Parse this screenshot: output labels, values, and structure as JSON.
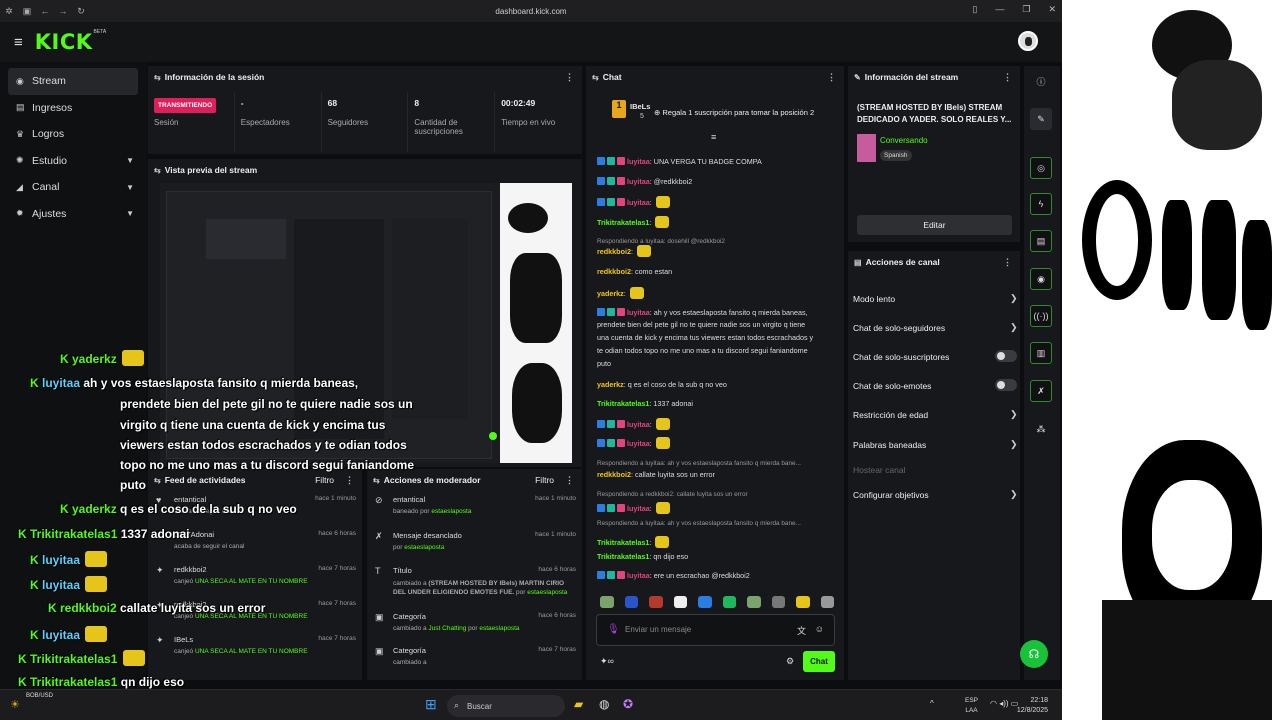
{
  "browser": {
    "url": "dashboard.kick.com"
  },
  "header": {
    "logo": "KICK",
    "beta": "BETA"
  },
  "sidebar": {
    "items": [
      {
        "label": "Stream",
        "icon": "broadcast-icon"
      },
      {
        "label": "Ingresos",
        "icon": "money-icon"
      },
      {
        "label": "Logros",
        "icon": "trophy-icon"
      },
      {
        "label": "Estudio",
        "icon": "gear-icon"
      },
      {
        "label": "Canal",
        "icon": "channel-icon"
      },
      {
        "label": "Ajustes",
        "icon": "settings-icon"
      }
    ]
  },
  "session": {
    "title": "Información de la sesión",
    "stats": [
      {
        "value": "TRANSMITIENDO",
        "label": "Sesión"
      },
      {
        "value": "-",
        "label": "Espectadores"
      },
      {
        "value": "68",
        "label": "Seguidores"
      },
      {
        "value": "8",
        "label": "Cantidad de suscripciones"
      },
      {
        "value": "00:02:49",
        "label": "Tiempo en vivo"
      }
    ]
  },
  "preview": {
    "title": "Vista previa del stream"
  },
  "feed": {
    "title": "Feed de actividades",
    "filter": "Filtro",
    "rows": [
      {
        "name": "entantical",
        "sub": "acaba de seguir el canal",
        "time": "hace 1 minuto"
      },
      {
        "name": "1337Adonai",
        "sub": "acaba de seguir el canal",
        "time": "hace 6 horas"
      },
      {
        "name": "redkkboi2",
        "sub": "canjeó",
        "reward": "UNA SECA AL MATE EN TU NOMBRE",
        "time": "hace 7 horas"
      },
      {
        "name": "redkkboi2",
        "sub": "canjeó",
        "reward": "UNA SECA AL MATE EN TU NOMBRE",
        "time": "hace 7 horas"
      },
      {
        "name": "IBeLs",
        "sub": "canjeó",
        "reward": "UNA SECA AL MATE EN TU NOMBRE",
        "time": "hace 7 horas"
      }
    ]
  },
  "mod": {
    "title": "Acciones de moderador",
    "filter": "Filtro",
    "rows": [
      {
        "name": "entantical",
        "sub": "baneado por",
        "by": "estaeslaposta",
        "time": "hace 1 minuto"
      },
      {
        "name": "Mensaje desanclado",
        "sub": "por",
        "by": "estaeslaposta",
        "time": "hace 1 minuto"
      },
      {
        "name": "Título",
        "sub": "cambiado a",
        "detail": "(STREAM HOSTED BY IBels) MARTIN CIRIO DEL UNDER ELIGIENDO EMOTES FUE.",
        "by": "estaeslaposta",
        "time": "hace 6 horas"
      },
      {
        "name": "Categoría",
        "sub": "cambiado a",
        "detail": "Just Chatting",
        "by": "estaeslaposta",
        "time": "hace 6 horas"
      },
      {
        "name": "Categoría",
        "sub": "cambiado a",
        "time": "hace 7 horas"
      }
    ]
  },
  "chat": {
    "title": "Chat",
    "top_user": "IBeLs",
    "top_count": "5",
    "gift_msg": "Regala 1 suscripción para tomar la posición 2",
    "placeholder": "Enviar un mensaje",
    "send": "Chat",
    "messages": [
      {
        "user": "luyitaa",
        "color": "#e0457b",
        "text": "UNA VERGA TU BADGE COMPA"
      },
      {
        "user": "luyitaa",
        "color": "#e0457b",
        "text": "@redkkboi2"
      },
      {
        "user": "luyitaa",
        "color": "#e0457b",
        "text": ""
      },
      {
        "user": "Trikitrakatelas1",
        "color": "#53fc18",
        "text": ""
      },
      {
        "reply": "Respondiendo a luyitaa: dosehill @redkkboi2"
      },
      {
        "user": "redkkboi2",
        "color": "#f0c419",
        "text": ""
      },
      {
        "user": "redkkboi2",
        "color": "#f0c419",
        "text": "como estan"
      },
      {
        "user": "yaderkz",
        "color": "#f0c419",
        "text": ""
      },
      {
        "user": "luyitaa",
        "color": "#e0457b",
        "text": "ah y vos estaeslaposta fansito q mierda baneas,"
      },
      {
        "text": "prendete bien del pete gil no te quiere nadie sos un virgito q tiene"
      },
      {
        "text": "una cuenta de kick y encima tus viewers estan todos escrachados y"
      },
      {
        "text": "te odian todos topo no me uno mas a tu discord segui faniandome"
      },
      {
        "text": "puto"
      },
      {
        "user": "yaderkz",
        "color": "#f0c419",
        "text": "q es el coso de la sub q no veo"
      },
      {
        "user": "Trikitrakatelas1",
        "color": "#53fc18",
        "text": "1337 adonai"
      },
      {
        "user": "luyitaa",
        "color": "#e0457b",
        "text": ""
      },
      {
        "user": "luyitaa",
        "color": "#e0457b",
        "text": ""
      },
      {
        "reply": "Respondiendo a luyitaa: ah y vos estaeslaposta fansito q mierda bane..."
      },
      {
        "user": "redkkboi2",
        "color": "#f0c419",
        "text": "callate luyita sos un error"
      },
      {
        "reply": "Respondiendo a redkkboi2: callate luyita sos un error"
      },
      {
        "user": "luyitaa",
        "color": "#e0457b",
        "text": ""
      },
      {
        "reply": "Respondiendo a luyitaa: ah y vos estaeslaposta fansito q mierda bane..."
      },
      {
        "user": "Trikitrakatelas1",
        "color": "#53fc18",
        "text": ""
      },
      {
        "user": "Trikitrakatelas1",
        "color": "#53fc18",
        "text": "qn dijo eso"
      },
      {
        "user": "luyitaa",
        "color": "#e0457b",
        "text": "ere un escrachao @redkkboi2"
      }
    ]
  },
  "stream_info": {
    "title": "Información del stream",
    "name": "(STREAM HOSTED BY IBels) STREAM DEDICADO A YADER. SOLO REALES Y...",
    "category": "Conversando",
    "language": "Spanish",
    "edit": "Editar"
  },
  "channel_actions": {
    "title": "Acciones de canal",
    "items": [
      {
        "label": "Modo lento",
        "kind": "chevron"
      },
      {
        "label": "Chat de solo-seguidores",
        "kind": "chevron"
      },
      {
        "label": "Chat de solo-suscriptores",
        "kind": "toggle"
      },
      {
        "label": "Chat de solo-emotes",
        "kind": "toggle"
      },
      {
        "label": "Restricción de edad",
        "kind": "chevron"
      },
      {
        "label": "Palabras baneadas",
        "kind": "chevron"
      },
      {
        "label": "Hostear canal",
        "kind": "disabled"
      },
      {
        "label": "Configurar objetivos",
        "kind": "chevron"
      }
    ]
  },
  "overlay": {
    "lines": [
      {
        "user": "yaderkz",
        "text": ""
      },
      {
        "user": "luyitaa",
        "text": "ah y vos estaeslaposta fansito q mierda baneas,"
      },
      {
        "text": "prendete bien del pete gil no te quiere nadie sos un"
      },
      {
        "text": "virgito q tiene una cuenta de kick y encima tus"
      },
      {
        "text": "viewers estan todos escrachados y te odian todos"
      },
      {
        "text": "topo no me uno mas a tu discord segui faniandome"
      },
      {
        "text": "puto"
      },
      {
        "user": "yaderkz",
        "text": "q es el coso de la sub q no veo"
      },
      {
        "user": "Trikitrakatelas1",
        "text": "1337 adonai"
      },
      {
        "user": "luyitaa",
        "text": ""
      },
      {
        "user": "luyitaa",
        "text": ""
      },
      {
        "user": "redkkboi2",
        "text": "callate luyita sos un error"
      },
      {
        "user": "luyitaa",
        "text": ""
      },
      {
        "user": "Trikitrakatelas1",
        "text": ""
      },
      {
        "user": "Trikitrakatelas1",
        "text": "qn dijo eso"
      },
      {
        "user": "luyitaa",
        "text": "ere un escrachao @redkkboi2"
      }
    ]
  },
  "taskbar": {
    "search": "Buscar",
    "weather": "BOB/USD",
    "lang": "ESP",
    "lang2": "LAA",
    "time": "22:18",
    "date": "12/8/2025"
  }
}
